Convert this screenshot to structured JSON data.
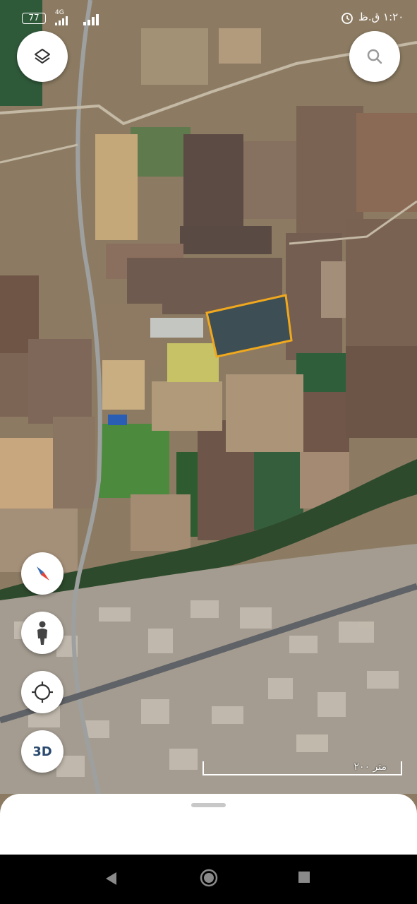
{
  "status_bar": {
    "battery": "77",
    "network_type": "4G",
    "time": "۱:۲۰ ق.ظ"
  },
  "map": {
    "scale_label": "۲۰۰ متر",
    "highlight_color": "#f0a81e"
  },
  "controls": {
    "three_d_label": "3D"
  },
  "icons": [
    "layers-icon",
    "search-icon",
    "compass-icon",
    "street-view-icon",
    "my-location-icon",
    "back-icon",
    "home-icon",
    "recents-icon"
  ]
}
